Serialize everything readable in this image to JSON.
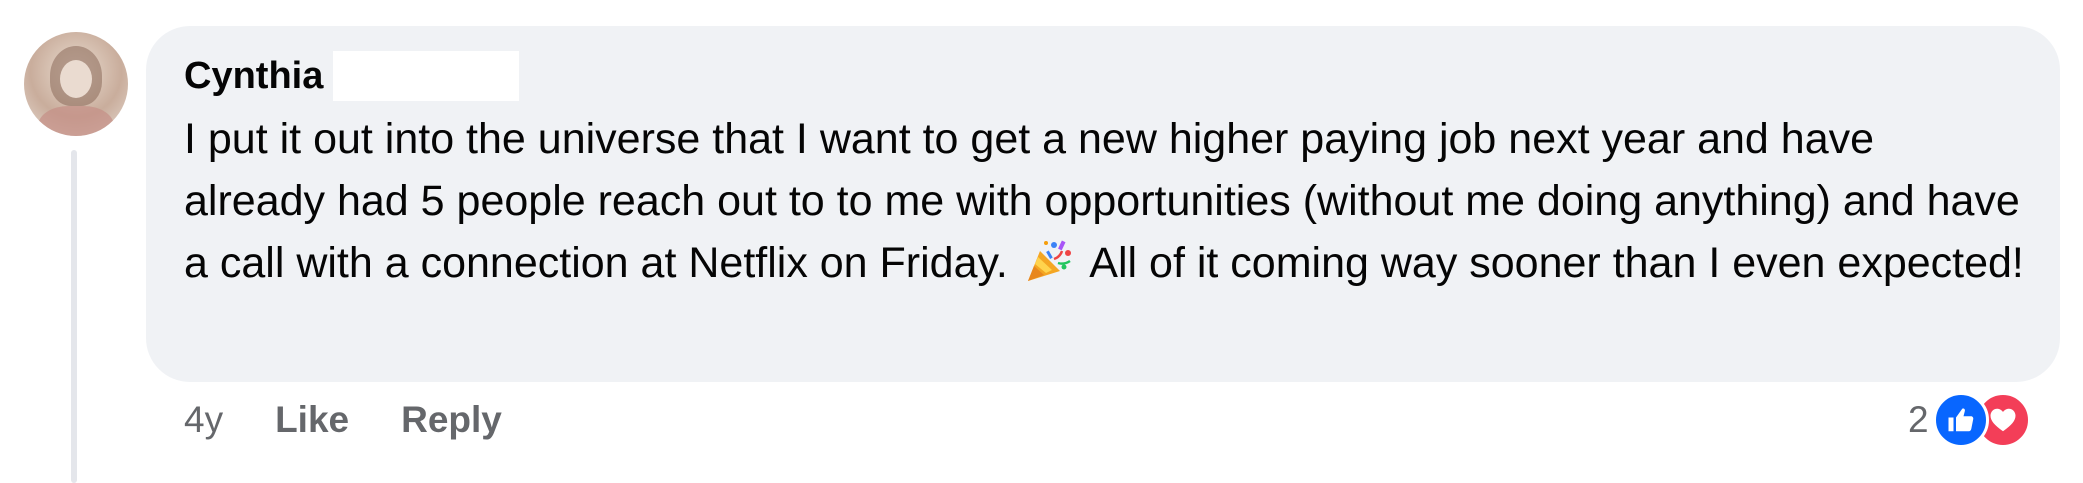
{
  "comment": {
    "author": "Cynthia",
    "text_before_emoji": "I put it out into the universe that I want to get a new higher paying job next year and have already had 5 people reach out to to me with opportunities (without me doing anything) and have a call with a connection at Netflix on Friday.",
    "emoji": "party-popper-icon",
    "text_after_emoji": "All of it coming way sooner than I even expected!"
  },
  "actions": {
    "time": "4y",
    "like_label": "Like",
    "reply_label": "Reply"
  },
  "reactions": {
    "count": "2",
    "types": [
      "like-icon",
      "love-icon"
    ]
  },
  "colors": {
    "bubble": "#f0f2f5",
    "like": "#0866ff",
    "love": "#f33e58",
    "secondary_text": "#65676b"
  }
}
